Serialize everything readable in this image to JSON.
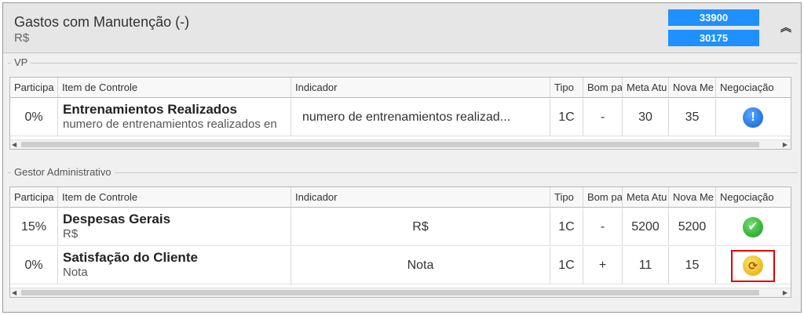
{
  "header": {
    "title": "Gastos com Manutenção (-)",
    "subtitle": "R$",
    "badges": [
      "33900",
      "30175"
    ],
    "collapse_icon": "double-chevron-up-icon"
  },
  "columns": [
    "Participa",
    "Item de Controle",
    "Indicador",
    "Tipo",
    "Bom pa",
    "Meta Atu",
    "Nova Me",
    "Negociação"
  ],
  "sections": [
    {
      "label": "VP",
      "rows": [
        {
          "participacao": "0%",
          "item_title": "Entrenamientos Realizados",
          "item_sub": "numero de entrenamientos realizados en",
          "indicador": "numero de entrenamientos realizad...",
          "tipo": "1C",
          "bom": "-",
          "meta": "30",
          "nova": "35",
          "status": "info-icon"
        }
      ]
    },
    {
      "label": "Gestor Administrativo",
      "rows": [
        {
          "participacao": "15%",
          "item_title": "Despesas Gerais",
          "item_sub": "R$",
          "indicador": "R$",
          "tipo": "1C",
          "bom": "-",
          "meta": "5200",
          "nova": "5200",
          "status": "check-icon"
        },
        {
          "participacao": "0%",
          "item_title": "Satisfação do Cliente",
          "item_sub": "Nota",
          "indicador": "Nota",
          "tipo": "1C",
          "bom": "+",
          "meta": "11",
          "nova": "15",
          "status": "negotiation-icon"
        }
      ]
    }
  ],
  "colors": {
    "badge": "#1e90ff",
    "highlight": "#e00000",
    "info": "#0b5fd1",
    "ok": "#1a9a1a",
    "warn": "#e0a800"
  }
}
